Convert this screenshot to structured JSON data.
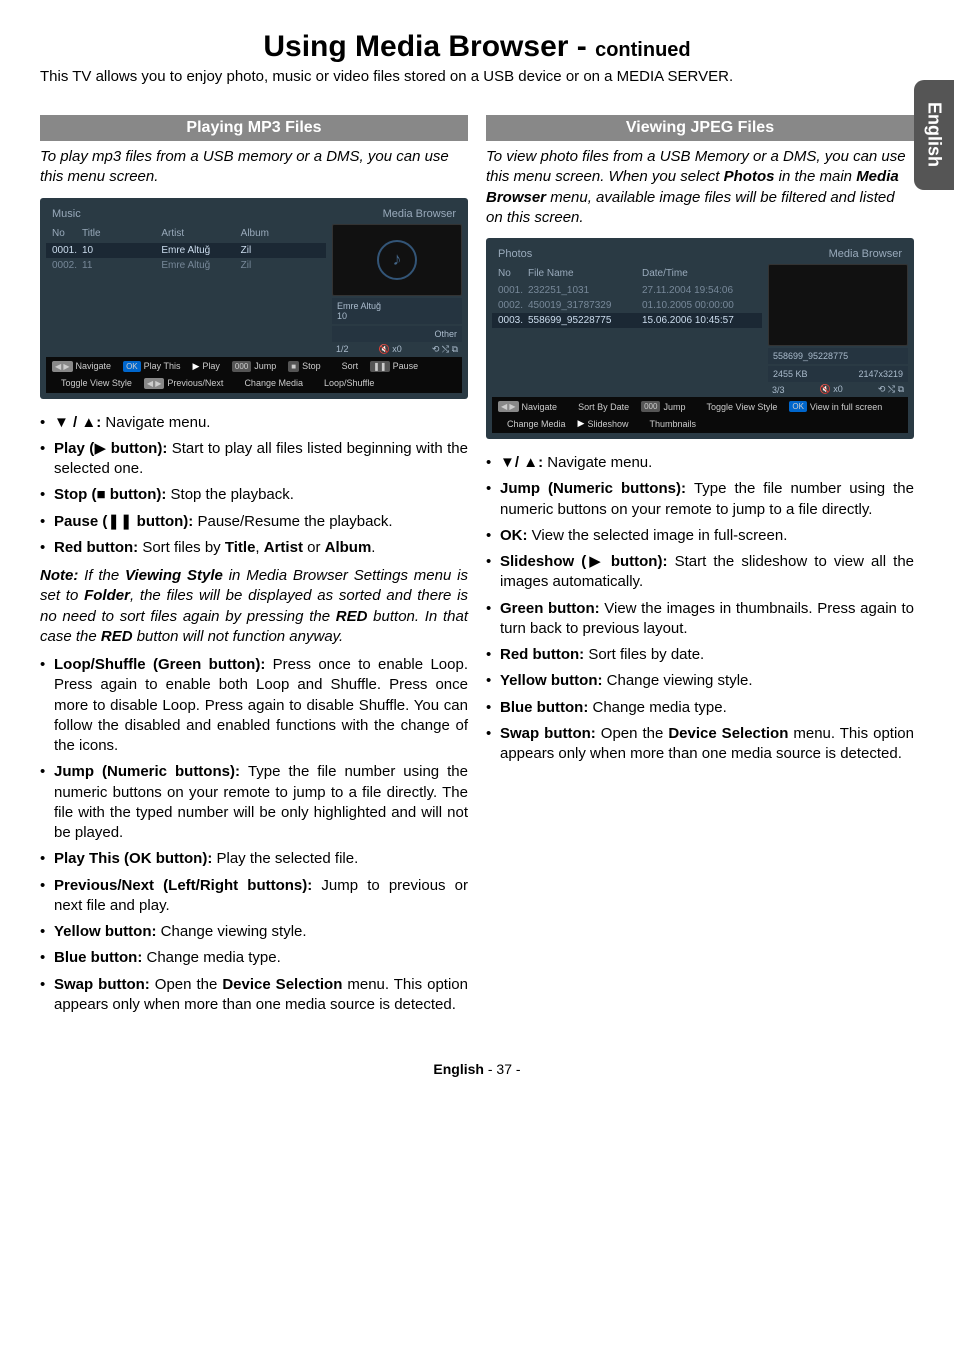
{
  "side_tab": "English",
  "title_main": "Using Media Browser - ",
  "title_suffix": "continued",
  "intro": "This TV allows you to enjoy photo, music or video files stored on a USB device or on a MEDIA SERVER.",
  "left": {
    "heading": "Playing MP3 Files",
    "lead": "To play mp3 files from a USB memory or a DMS, you can use this menu screen.",
    "screen": {
      "title": "Music",
      "corner": "Media Browser",
      "cols": [
        "No",
        "Title",
        "Artist",
        "Album"
      ],
      "rows": [
        {
          "no": "0001.",
          "title": "10",
          "artist": "Emre Altuğ",
          "album": "Zil"
        },
        {
          "no": "0002.",
          "title": "11",
          "artist": "Emre Altuğ",
          "album": "Zil"
        }
      ],
      "preview_caption1": "Emre Altuğ",
      "preview_caption2": "10",
      "preview_genre": "Other",
      "counter": "1/2",
      "vol": "🔇 x0",
      "flags": "⟲ ⤭ ⧉",
      "footer": [
        {
          "badge": "b-nav",
          "icon": "◀ ▶",
          "label": "Navigate"
        },
        {
          "badge": "b-ok",
          "icon": "OK",
          "label": "Play This"
        },
        {
          "badge": "b-play",
          "icon": "▶",
          "label": "Play"
        },
        {
          "badge": "b-gray",
          "icon": "000",
          "label": "Jump"
        },
        {
          "badge": "b-gray",
          "icon": "■",
          "label": "Stop"
        },
        {
          "badge": "b-red",
          "icon": " ",
          "label": "Sort"
        },
        {
          "badge": "b-gray",
          "icon": "❚❚",
          "label": "Pause"
        },
        {
          "badge": "b-yellow",
          "icon": " ",
          "label": "Toggle View Style"
        },
        {
          "badge": "b-nav",
          "icon": "◀ ▶",
          "label": "Previous/Next"
        },
        {
          "badge": "b-blue",
          "icon": " ",
          "label": "Change Media"
        },
        {
          "badge": "b-green",
          "icon": " ",
          "label": "Loop/Shuffle"
        }
      ]
    },
    "items": {
      "nav": "Navigate menu.",
      "play_label": "Play (",
      "play_button_txt": " button): ",
      "play_desc": "Start to play all files listed beginning with the selected one.",
      "stop_label": "Stop (",
      "stop_button_txt": " button): ",
      "stop_desc": "Stop the playback.",
      "pause_label": "Pause (",
      "pause_button_txt": " button): ",
      "pause_desc": "Pause/Resume the playback.",
      "red_label": "Red button: ",
      "red_desc_a": "Sort files by ",
      "red_desc_b": "Title",
      "red_desc_c": ", ",
      "red_desc_d": "Artist",
      "red_desc_e": " or ",
      "red_desc_f": "Album",
      "red_desc_g": ".",
      "note_lead": "Note:",
      "note_a": " If the ",
      "note_b": "Viewing Style",
      "note_c": " in Media Browser Settings menu is set to ",
      "note_d": "Folder",
      "note_e": ", the files will be displayed as sorted and there is no need to sort files again by pressing the ",
      "note_f": "RED",
      "note_g": " button. In that case the ",
      "note_h": "RED",
      "note_i": " button will not function anyway.",
      "loop_label": "Loop/Shuffle (Green button): ",
      "loop_desc": "Press once to enable Loop. Press again to enable both Loop and Shuffle. Press once more to disable Loop. Press again to disable Shuffle. You can follow the disabled and enabled functions with the change of the icons.",
      "jump_label": "Jump (Numeric buttons): ",
      "jump_desc": "Type the file number using the numeric buttons on your remote to jump to a file directly. The file with the typed number will be only highlighted and will not be played.",
      "playthis_label": "Play This (OK button): ",
      "playthis_desc": "Play the selected file.",
      "prevnext_label": "Previous/Next (Left/Right buttons): ",
      "prevnext_desc": "Jump to previous or next file and play.",
      "yellow_label": "Yellow button: ",
      "yellow_desc": "Change viewing style.",
      "blue_label": "Blue button: ",
      "blue_desc": "Change media type.",
      "swap_label": "Swap button: ",
      "swap_desc_a": "Open the ",
      "swap_desc_b": "Device Selection",
      "swap_desc_c": " menu. This option appears only when more than one media source is detected."
    }
  },
  "right": {
    "heading": "Viewing JPEG Files",
    "lead_a": "To view photo files from a USB Memory or a DMS, you can use this menu screen. When you select ",
    "lead_b": "Photos",
    "lead_c": " in the main ",
    "lead_d": "Media Browser",
    "lead_e": " menu, available image files will be filtered and listed on this screen.",
    "screen": {
      "title": "Photos",
      "corner": "Media Browser",
      "cols": [
        "No",
        "File Name",
        "Date/Time"
      ],
      "rows": [
        {
          "no": "0001.",
          "name": "232251_1031",
          "dt": "27.11.2004 19:54:06"
        },
        {
          "no": "0002.",
          "name": "450019_31787329",
          "dt": "01.10.2005 00:00:00"
        },
        {
          "no": "0003.",
          "name": "558699_95228775",
          "dt": "15.06.2006 10:45:57"
        }
      ],
      "preview_name": "558699_95228775",
      "size": "2455 KB",
      "dims": "2147x3219",
      "counter": "3/3",
      "vol": "🔇 x0",
      "flags": "⟲ ⤭ ⧉",
      "footer": [
        {
          "badge": "b-nav",
          "icon": "◀ ▶",
          "label": "Navigate"
        },
        {
          "badge": "b-red",
          "icon": " ",
          "label": "Sort By Date"
        },
        {
          "badge": "b-gray",
          "icon": "000",
          "label": "Jump"
        },
        {
          "badge": "b-yellow",
          "icon": " ",
          "label": "Toggle View Style"
        },
        {
          "badge": "b-ok",
          "icon": "OK",
          "label": "View in full screen"
        },
        {
          "badge": "b-blue",
          "icon": " ",
          "label": "Change Media"
        },
        {
          "badge": "b-play",
          "icon": "▶",
          "label": "Slideshow"
        },
        {
          "badge": "b-green",
          "icon": " ",
          "label": "Thumbnails"
        }
      ]
    },
    "items": {
      "nav": "Navigate menu.",
      "jump_label": "Jump (Numeric buttons): ",
      "jump_desc": "Type the file number using the numeric buttons on your remote to jump to a file directly.",
      "ok_label": "OK: ",
      "ok_desc": "View the selected image in full-screen.",
      "slide_label": "Slideshow (",
      "slide_button_txt": " button): ",
      "slide_desc": "Start the slideshow to view all the images automatically.",
      "green_label": "Green button: ",
      "green_desc": "View the images in thumbnails. Press again to turn back to previous layout.",
      "red_label": "Red button: ",
      "red_desc": "Sort files by date.",
      "yellow_label": "Yellow button: ",
      "yellow_desc": "Change viewing style.",
      "blue_label": "Blue button: ",
      "blue_desc": "Change media type.",
      "swap_label": "Swap button: ",
      "swap_desc_a": "Open the ",
      "swap_desc_b": "Device Selection",
      "swap_desc_c": " menu. This option appears only when more than one media source is detected."
    }
  },
  "footer_lang": "English",
  "footer_page": "  - 37 -"
}
